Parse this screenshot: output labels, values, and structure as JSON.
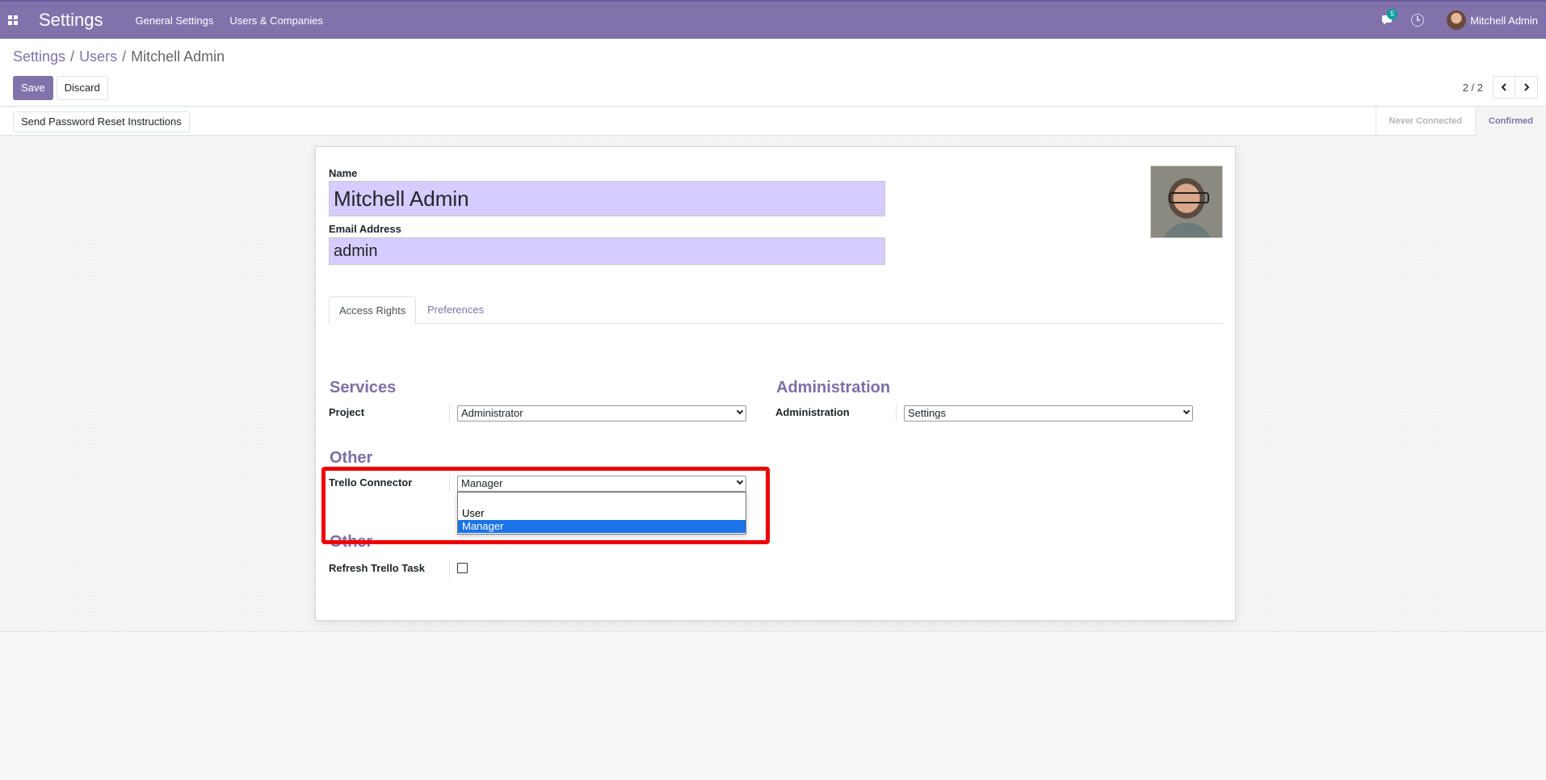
{
  "navbar": {
    "app_title": "Settings",
    "menu": [
      "General Settings",
      "Users & Companies"
    ],
    "chat_count": "5",
    "user_name": "Mitchell Admin"
  },
  "breadcrumb": {
    "items": [
      "Settings",
      "Users",
      "Mitchell Admin"
    ]
  },
  "actions": {
    "save_label": "Save",
    "discard_label": "Discard"
  },
  "pager": {
    "value": "2 / 2"
  },
  "statusbar": {
    "reset_button": "Send Password Reset Instructions",
    "stages": [
      "Never Connected",
      "Confirmed"
    ],
    "current_stage": "Confirmed"
  },
  "form": {
    "name_label": "Name",
    "name_value": "Mitchell Admin",
    "email_label": "Email Address",
    "email_value": "admin",
    "tabs": [
      "Access Rights",
      "Preferences"
    ],
    "active_tab": "Access Rights",
    "services": {
      "title": "Services",
      "project_label": "Project",
      "project_value": "Administrator"
    },
    "administration": {
      "title": "Administration",
      "label": "Administration",
      "value": "Settings"
    },
    "other1": {
      "title": "Other",
      "trello_label": "Trello Connector",
      "trello_value": "Manager",
      "trello_options": [
        "User",
        "Manager"
      ],
      "trello_selected_option": "Manager"
    },
    "other2": {
      "title": "Other",
      "refresh_label": "Refresh Trello Task",
      "refresh_checked": false
    }
  },
  "colors": {
    "brand": "#8172ab",
    "highlight": "#ee0000",
    "input_bg": "#d6ccff",
    "option_selected": "#1a73e8"
  }
}
